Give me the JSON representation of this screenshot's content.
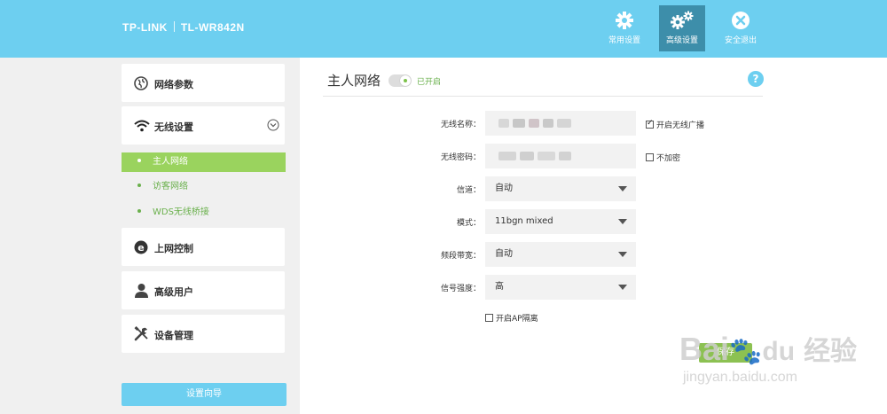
{
  "header": {
    "brand": "TP-LINK",
    "model": "TL-WR842N",
    "nav": [
      {
        "label": "常用设置",
        "icon": "gear-icon"
      },
      {
        "label": "高级设置",
        "icon": "gears-icon"
      },
      {
        "label": "安全退出",
        "icon": "close-circle-icon"
      }
    ]
  },
  "sidebar": {
    "items": [
      {
        "label": "网络参数",
        "icon": "globe-icon"
      },
      {
        "label": "无线设置",
        "icon": "wifi-icon"
      },
      {
        "label": "上网控制",
        "icon": "internet-icon"
      },
      {
        "label": "高级用户",
        "icon": "user-icon"
      },
      {
        "label": "设备管理",
        "icon": "tools-icon"
      }
    ],
    "sub_items": [
      {
        "label": "主人网络"
      },
      {
        "label": "访客网络"
      },
      {
        "label": "WDS无线桥接"
      }
    ],
    "wizard_label": "设置向导"
  },
  "main": {
    "title": "主人网络",
    "toggle_label": "已开启",
    "toggle_on": true,
    "help": "?",
    "fields": {
      "ssid_label": "无线名称：",
      "password_label": "无线密码：",
      "channel_label": "信道：",
      "channel_value": "自动",
      "mode_label": "模式：",
      "mode_value": "11bgn mixed",
      "bandwidth_label": "频段带宽：",
      "bandwidth_value": "自动",
      "power_label": "信号强度：",
      "power_value": "高"
    },
    "checkboxes": {
      "broadcast": {
        "label": "开启无线广播",
        "checked": true
      },
      "no_encrypt": {
        "label": "不加密",
        "checked": false
      },
      "ap_isolation": {
        "label": "开启AP隔离",
        "checked": false
      }
    },
    "save_label": "保存"
  },
  "watermark": {
    "brand": "Bai",
    "brand2": "du",
    "cn": "经验",
    "url": "jingyan.baidu.com"
  },
  "colors": {
    "accent": "#6dcff0",
    "green": "#8cc152",
    "active_nav": "#3d8eaa"
  }
}
